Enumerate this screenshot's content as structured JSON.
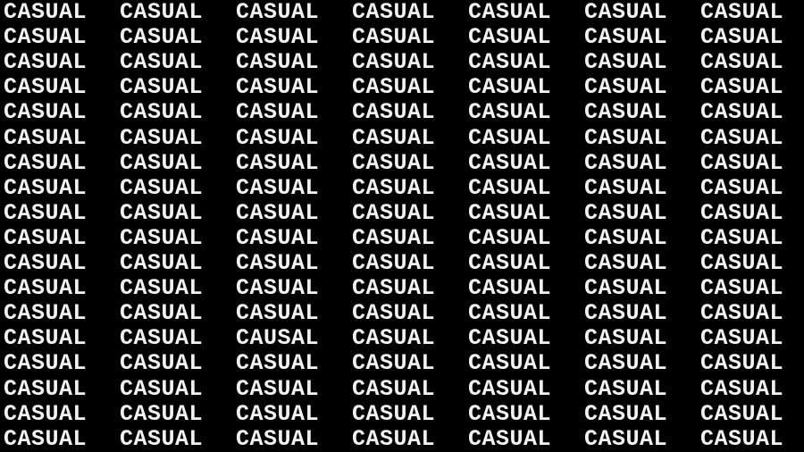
{
  "puzzle": {
    "background_color": "#000000",
    "text_color": "#f2f2f2",
    "rows": [
      [
        "CASUAL",
        "CASUAL",
        "CASUAL",
        "CASUAL",
        "CASUAL",
        "CASUAL",
        "CASUAL"
      ],
      [
        "CASUAL",
        "CASUAL",
        "CASUAL",
        "CASUAL",
        "CASUAL",
        "CASUAL",
        "CASUAL"
      ],
      [
        "CASUAL",
        "CASUAL",
        "CASUAL",
        "CASUAL",
        "CASUAL",
        "CASUAL",
        "CASUAL"
      ],
      [
        "CASUAL",
        "CASUAL",
        "CASUAL",
        "CASUAL",
        "CASUAL",
        "CASUAL",
        "CASUAL"
      ],
      [
        "CASUAL",
        "CASUAL",
        "CASUAL",
        "CASUAL",
        "CASUAL",
        "CASUAL",
        "CASUAL"
      ],
      [
        "CASUAL",
        "CASUAL",
        "CASUAL",
        "CASUAL",
        "CASUAL",
        "CASUAL",
        "CASUAL"
      ],
      [
        "CASUAL",
        "CASUAL",
        "CASUAL",
        "CASUAL",
        "CASUAL",
        "CASUAL",
        "CASUAL"
      ],
      [
        "CASUAL",
        "CASUAL",
        "CASUAL",
        "CASUAL",
        "CASUAL",
        "CASUAL",
        "CASUAL"
      ],
      [
        "CASUAL",
        "CASUAL",
        "CASUAL",
        "CASUAL",
        "CASUAL",
        "CASUAL",
        "CASUAL"
      ],
      [
        "CASUAL",
        "CASUAL",
        "CASUAL",
        "CASUAL",
        "CASUAL",
        "CASUAL",
        "CASUAL"
      ],
      [
        "CASUAL",
        "CASUAL",
        "CASUAL",
        "CASUAL",
        "CASUAL",
        "CASUAL",
        "CASUAL"
      ],
      [
        "CASUAL",
        "CASUAL",
        "CASUAL",
        "CASUAL",
        "CASUAL",
        "CASUAL",
        "CASUAL"
      ],
      [
        "CASUAL",
        "CASUAL",
        "CASUAL",
        "CASUAL",
        "CASUAL",
        "CASUAL",
        "CASUAL"
      ],
      [
        "CASUAL",
        "CASUAL",
        "CAUSAL",
        "CASUAL",
        "CASUAL",
        "CASUAL",
        "CASUAL"
      ],
      [
        "CASUAL",
        "CASUAL",
        "CASUAL",
        "CASUAL",
        "CASUAL",
        "CASUAL",
        "CASUAL"
      ],
      [
        "CASUAL",
        "CASUAL",
        "CASUAL",
        "CASUAL",
        "CASUAL",
        "CASUAL",
        "CASUAL"
      ],
      [
        "CASUAL",
        "CASUAL",
        "CASUAL",
        "CASUAL",
        "CASUAL",
        "CASUAL",
        "CASUAL"
      ],
      [
        "CASUAL",
        "CASUAL",
        "CASUAL",
        "CASUAL",
        "CASUAL",
        "CASUAL",
        "CASUAL"
      ]
    ]
  }
}
